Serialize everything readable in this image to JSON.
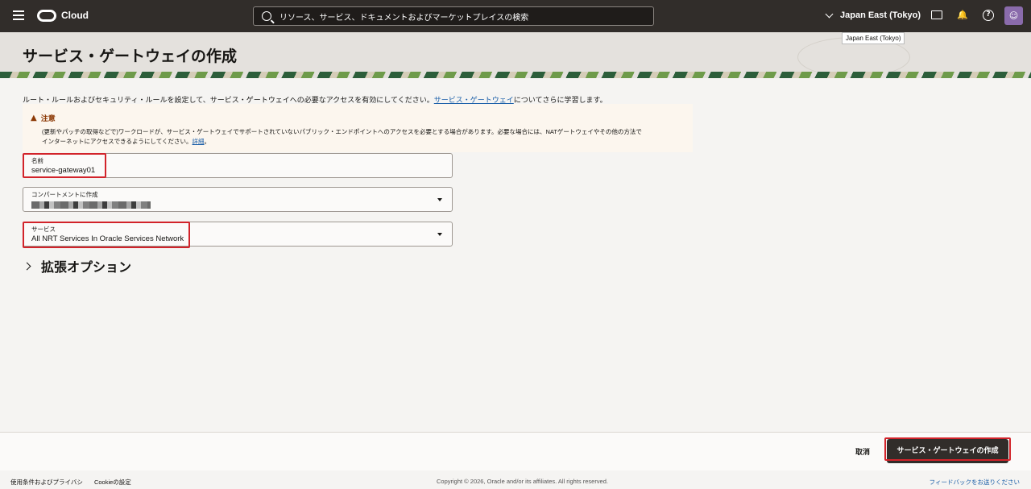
{
  "topbar": {
    "logo_text": "Cloud",
    "search_placeholder": "リソース、サービス、ドキュメントおよびマーケットプレイスの検索",
    "region": "Japan East (Tokyo)",
    "region_tooltip": "Japan East (Tokyo)"
  },
  "page": {
    "title": "サービス・ゲートウェイの作成",
    "intro_text": "ルート・ルールおよびセキュリティ・ルールを設定して、サービス・ゲートウェイへの必要なアクセスを有効にしてください。",
    "intro_link": "サービス・ゲートウェイ",
    "intro_suffix": "についてさらに学習します。"
  },
  "notice": {
    "title": "注意",
    "line1": "(更新やパッチの取得などで)ワークロードが、サービス・ゲートウェイでサポートされていないパブリック・エンドポイントへのアクセスを必要とする場合があります。必要な場合には、NATゲートウェイやその他の方法で",
    "line2": "インターネットにアクセスできるようにしてください。",
    "link": "詳細"
  },
  "form": {
    "name_label": "名前",
    "name_value": "service-gateway01",
    "compartment_label": "コンパートメントに作成",
    "service_label": "サービス",
    "service_value": "All NRT Services In Oracle Services Network",
    "advanced_label": "拡張オプション"
  },
  "actions": {
    "cancel": "取消",
    "create": "サービス・ゲートウェイの作成"
  },
  "footer": {
    "terms": "使用条件およびプライバシ",
    "cookies": "Cookieの設定",
    "copyright": "Copyright © 2026, Oracle and/or its affiliates. All rights reserved.",
    "feedback": "フィードバックをお送りください"
  }
}
